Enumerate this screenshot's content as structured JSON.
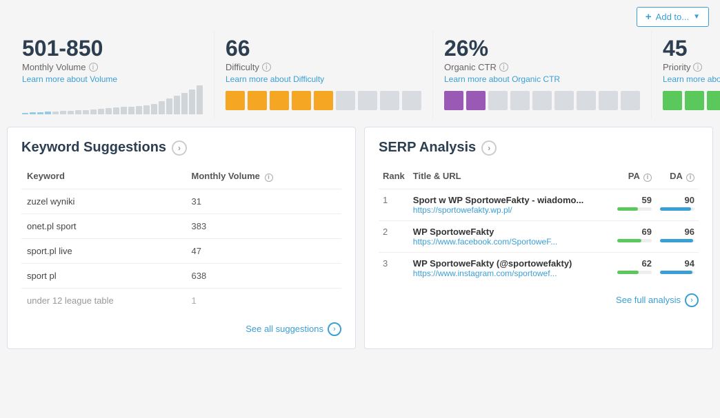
{
  "topbar": {
    "add_button_label": "Add to...",
    "add_button_icon": "+"
  },
  "metrics": {
    "volume": {
      "value": "501-850",
      "label": "Monthly Volume",
      "link_text": "Learn more about Volume",
      "bars": [
        2,
        3,
        3,
        4,
        4,
        5,
        5,
        6,
        6,
        7,
        8,
        9,
        10,
        11,
        12,
        13,
        14,
        16,
        20,
        24,
        28,
        32,
        38,
        44
      ]
    },
    "difficulty": {
      "value": "66",
      "label": "Difficulty",
      "link_text": "Learn more about Difficulty",
      "blocks_filled": 5,
      "blocks_total": 9,
      "color": "#f5a623"
    },
    "organic_ctr": {
      "value": "26%",
      "label": "Organic CTR",
      "link_text": "Learn more about Organic CTR",
      "blocks_filled": 2,
      "blocks_total": 9,
      "color": "#9b59b6"
    },
    "priority": {
      "value": "45",
      "label": "Priority",
      "link_text": "Learn more about Priority",
      "blocks_filled": 3,
      "blocks_total": 9,
      "color": "#5bc85b"
    }
  },
  "keyword_suggestions": {
    "title": "Keyword Suggestions",
    "col_keyword": "Keyword",
    "col_volume": "Monthly Volume",
    "see_all_label": "See all suggestions",
    "rows": [
      {
        "keyword": "zuzel wyniki",
        "volume": "31"
      },
      {
        "keyword": "onet.pl sport",
        "volume": "383"
      },
      {
        "keyword": "sport.pl live",
        "volume": "47"
      },
      {
        "keyword": "sport pl",
        "volume": "638"
      },
      {
        "keyword": "under 12 league table",
        "volume": "1"
      }
    ]
  },
  "serp_analysis": {
    "title": "SERP Analysis",
    "col_rank": "Rank",
    "col_title_url": "Title & URL",
    "col_pa": "PA",
    "col_da": "DA",
    "see_full_label": "See full analysis",
    "rows": [
      {
        "rank": "1",
        "title": "Sport w WP SportoweFakty - wiadomo...",
        "url": "https://sportowefakty.wp.pl/",
        "pa": "59",
        "da": "90",
        "pa_pct": 59,
        "da_pct": 90
      },
      {
        "rank": "2",
        "title": "WP SportoweFakty",
        "url": "https://www.facebook.com/SportoweF...",
        "pa": "69",
        "da": "96",
        "pa_pct": 69,
        "da_pct": 96
      },
      {
        "rank": "3",
        "title": "WP SportoweFakty (@sportowefakty)",
        "url": "https://www.instagram.com/sportowef...",
        "pa": "62",
        "da": "94",
        "pa_pct": 62,
        "da_pct": 94
      }
    ]
  }
}
